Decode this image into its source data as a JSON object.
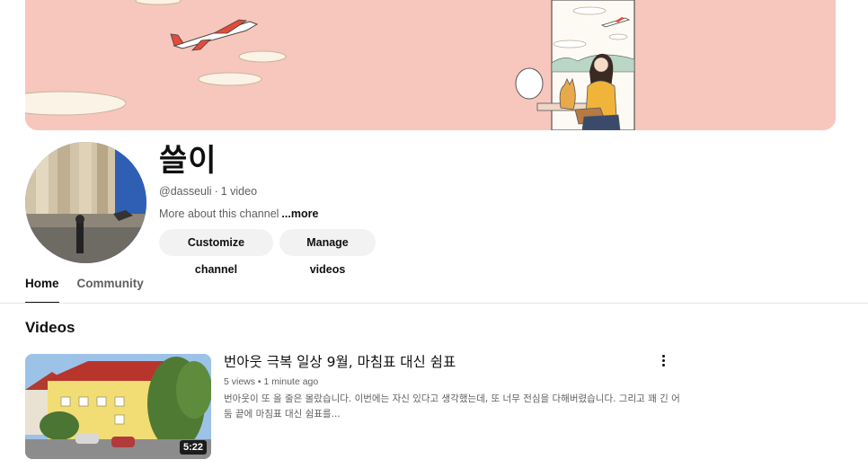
{
  "channel": {
    "name": "쓸이",
    "handle": "@dasseuli",
    "video_count": "1 video",
    "about_text": "More about this channel",
    "about_more": "...more"
  },
  "actions": {
    "customize_label": "Customize channel",
    "manage_label": "Manage videos"
  },
  "tabs": [
    {
      "label": "Home",
      "active": true
    },
    {
      "label": "Community",
      "active": false
    }
  ],
  "sections": {
    "videos_title": "Videos"
  },
  "video": {
    "title": "번아웃 극복 일상 9월, 마침표 대신 쉼표",
    "views": "5 views",
    "age": "1 minute ago",
    "description": "번아웃이 또 올 줄은 몰랐습니다. 이번에는 자신 있다고 생각했는데, 또 너무 전심을 다해버렸습니다. 그리고 꽤 긴 어둠 끝에 마침표 대신 쉼표를...",
    "duration": "5:22"
  },
  "colors": {
    "banner_bg": "#f7c6bc",
    "chip_bg": "#f2f2f2",
    "text_primary": "#0f0f0f",
    "text_secondary": "#606060"
  }
}
